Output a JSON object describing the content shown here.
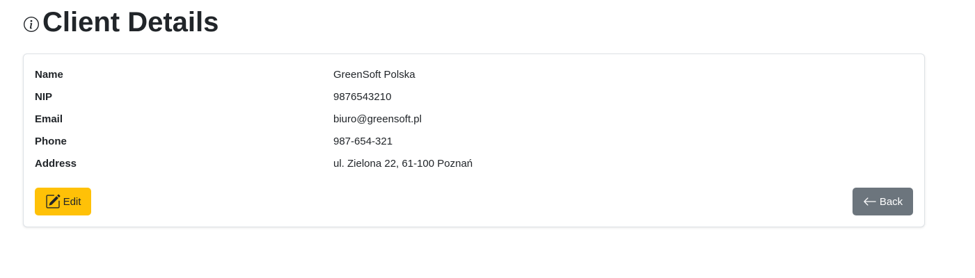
{
  "page": {
    "title": "Client Details",
    "title_icon": "info-circle-icon"
  },
  "client": {
    "fields": [
      {
        "label": "Name",
        "value": "GreenSoft Polska"
      },
      {
        "label": "NIP",
        "value": "9876543210"
      },
      {
        "label": "Email",
        "value": "biuro@greensoft.pl"
      },
      {
        "label": "Phone",
        "value": "987-654-321"
      },
      {
        "label": "Address",
        "value": "ul. Zielona 22, 61-100 Poznań"
      }
    ]
  },
  "actions": {
    "edit_label": "Edit",
    "edit_icon": "pencil-square-icon",
    "back_label": "Back",
    "back_icon": "arrow-left-icon"
  },
  "colors": {
    "edit_button": "#ffc107",
    "back_button": "#6c757d",
    "text": "#212529",
    "card_border": "#dee2e6"
  }
}
